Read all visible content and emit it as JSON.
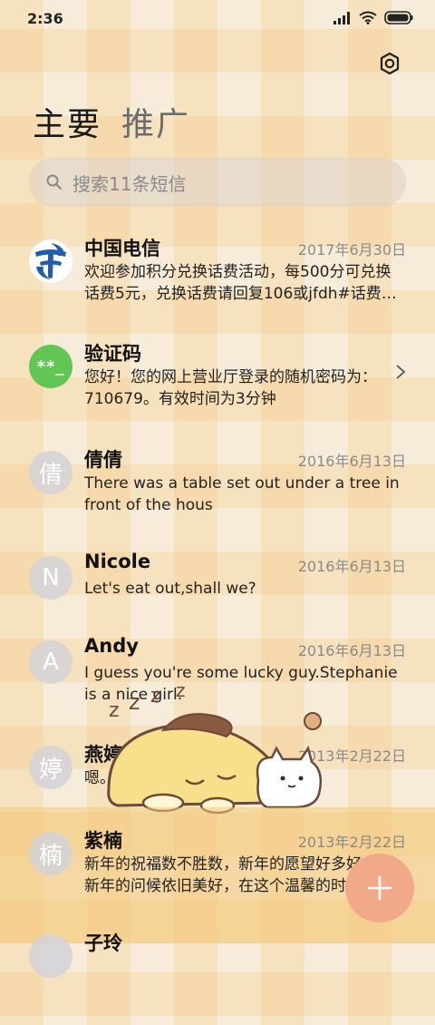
{
  "status_bar": {
    "time": "2:36"
  },
  "tabs": [
    {
      "label": "主要"
    },
    {
      "label": "推广"
    }
  ],
  "search": {
    "placeholder": "搜索11条短信"
  },
  "messages": [
    {
      "name": "中国电信",
      "date": "2017年6月30日",
      "preview": "欢迎参加积分兑换话费活动，每500分可兑换话费5元，兑换话费请回复106或jfdh#话费…",
      "avatar": "telecom-logo"
    },
    {
      "name": "验证码",
      "date": "",
      "preview": "您好！您的网上营业厅登录的随机密码为：710679。有效时间为3分钟",
      "avatar_text": "**_"
    },
    {
      "name": "倩倩",
      "date": "2016年6月13日",
      "preview": "There was a table set out under a tree in front of the hous",
      "avatar_text": "倩"
    },
    {
      "name": "Nicole",
      "date": "2016年6月13日",
      "preview": "Let's eat out,shall we?",
      "avatar_text": "N"
    },
    {
      "name": "Andy",
      "date": "2016年6月13日",
      "preview": "I guess you're some lucky guy.Stephanie is a nice girl.",
      "avatar_text": "A"
    },
    {
      "name": "燕婷",
      "date": "2013年2月22日",
      "preview": "嗯。收到啦。同乐同乐。",
      "avatar_text": "婷"
    },
    {
      "name": "紫楠",
      "date": "2013年2月22日",
      "preview": "新年的祝福数不胜数，新年的愿望好多好多，新年的问候依旧美好，在这个温馨的时刻",
      "avatar_text": "楠"
    },
    {
      "name": "子玲",
      "date": "",
      "preview": "",
      "avatar_text": ""
    }
  ],
  "colors": {
    "accent_fab": "#f2a98a",
    "verification_avatar": "#62c654",
    "telecom_blue": "#1f5fa9"
  },
  "icons": {
    "settings": "settings-icon",
    "search": "search-icon",
    "fab": "plus-icon"
  }
}
